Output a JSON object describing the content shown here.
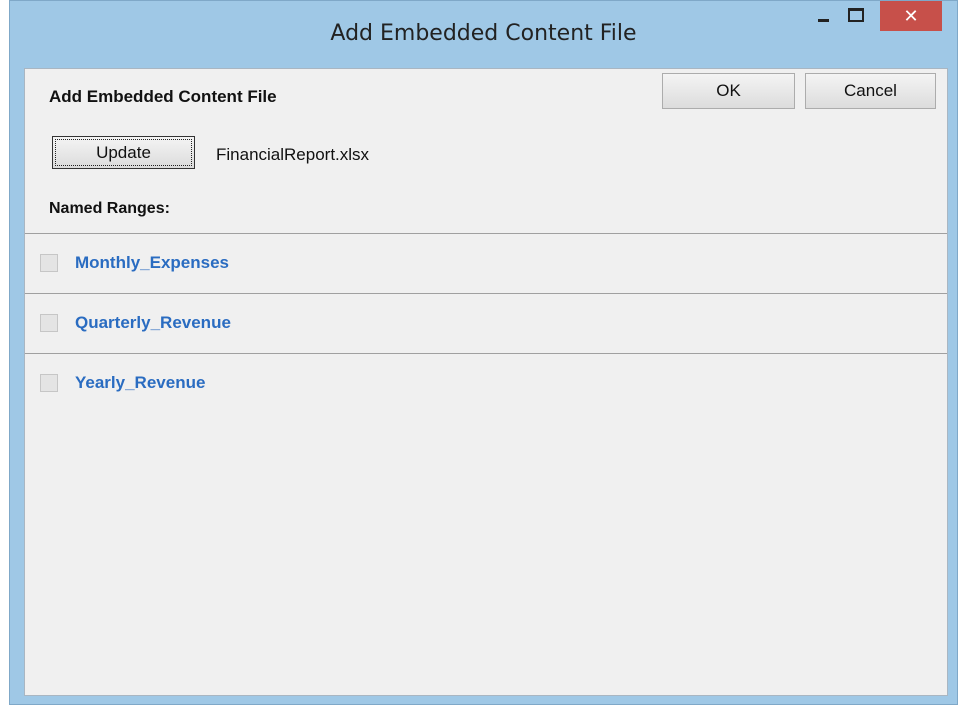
{
  "window": {
    "title": "Add Embedded Content File",
    "close_glyph": "✕"
  },
  "dialog": {
    "heading": "Add Embedded Content File",
    "ok_label": "OK",
    "cancel_label": "Cancel",
    "update_label": "Update",
    "file_name": "FinancialReport.xlsx",
    "named_ranges_label": "Named Ranges:"
  },
  "named_ranges": [
    {
      "label": "Monthly_Expenses",
      "checked": false
    },
    {
      "label": "Quarterly_Revenue",
      "checked": false
    },
    {
      "label": "Yearly_Revenue",
      "checked": false
    }
  ],
  "colors": {
    "close_button": "#c7504a",
    "range_link": "#2a6cc1",
    "window_frame": "#9fc8e6"
  }
}
